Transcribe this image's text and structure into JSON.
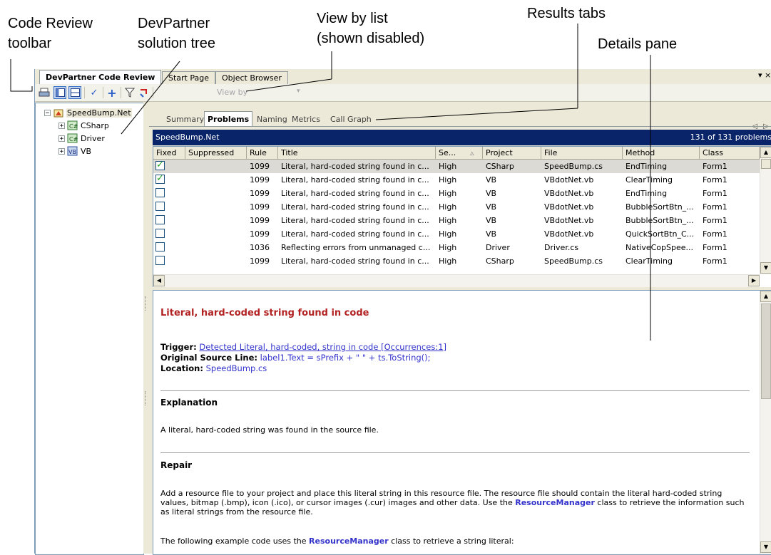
{
  "callouts": {
    "code_review_toolbar": "Code Review\ntoolbar",
    "solution_tree": "DevPartner\nsolution tree",
    "view_by_list": "View by list\n(shown disabled)",
    "results_tabs": "Results tabs",
    "details_pane": "Details pane"
  },
  "doc_tabs": [
    "DevPartner Code Review",
    "Start Page",
    "Object Browser"
  ],
  "window_controls": {
    "dropdown": "▾",
    "close": "×"
  },
  "toolbar": {
    "view_by_label": "View by",
    "view_by_arrow": "▾",
    "icons": [
      "print-icon",
      "tree-pane-icon",
      "split-pane-icon",
      "check-icon",
      "add-icon",
      "filter-icon",
      "refresh-icon"
    ]
  },
  "tree": {
    "root": "SpeedBump.Net",
    "children": [
      "CSharp",
      "Driver",
      "VB"
    ]
  },
  "results_tabs": [
    "Summary",
    "Problems",
    "Naming",
    "Metrics",
    "Call Graph"
  ],
  "tab_nav": {
    "prev": "◁",
    "next": "▷"
  },
  "results_header": {
    "title": "SpeedBump.Net",
    "count": "131 of 131 problems"
  },
  "grid": {
    "columns": [
      "Fixed",
      "Suppressed",
      "Rule",
      "Title",
      "Se...",
      "Project",
      "File",
      "Method",
      "Class"
    ],
    "rows": [
      {
        "fixed": true,
        "rule": "1099",
        "title": "Literal, hard-coded string found in c...",
        "severity": "High",
        "project": "CSharp",
        "file": "SpeedBump.cs",
        "method": "EndTiming",
        "class": "Form1"
      },
      {
        "fixed": true,
        "rule": "1099",
        "title": "Literal, hard-coded string found in c...",
        "severity": "High",
        "project": "VB",
        "file": "VBdotNet.vb",
        "method": "ClearTiming",
        "class": "Form1"
      },
      {
        "fixed": false,
        "rule": "1099",
        "title": "Literal, hard-coded string found in c...",
        "severity": "High",
        "project": "VB",
        "file": "VBdotNet.vb",
        "method": "EndTiming",
        "class": "Form1"
      },
      {
        "fixed": false,
        "rule": "1099",
        "title": "Literal, hard-coded string found in c...",
        "severity": "High",
        "project": "VB",
        "file": "VBdotNet.vb",
        "method": "BubbleSortBtn_...",
        "class": "Form1"
      },
      {
        "fixed": false,
        "rule": "1099",
        "title": "Literal, hard-coded string found in c...",
        "severity": "High",
        "project": "VB",
        "file": "VBdotNet.vb",
        "method": "BubbleSortBtn_...",
        "class": "Form1"
      },
      {
        "fixed": false,
        "rule": "1099",
        "title": "Literal, hard-coded string found in c...",
        "severity": "High",
        "project": "VB",
        "file": "VBdotNet.vb",
        "method": "QuickSortBtn_C...",
        "class": "Form1"
      },
      {
        "fixed": false,
        "rule": "1036",
        "title": "Reflecting errors from unmanaged c...",
        "severity": "High",
        "project": "Driver",
        "file": "Driver.cs",
        "method": "NativeCopSpee...",
        "class": "Form1"
      },
      {
        "fixed": false,
        "rule": "1099",
        "title": "Literal, hard-coded string found in c...",
        "severity": "High",
        "project": "CSharp",
        "file": "SpeedBump.cs",
        "method": "ClearTiming",
        "class": "Form1"
      }
    ]
  },
  "details": {
    "title": "Literal, hard-coded string found in code",
    "trigger_label": "Trigger:",
    "trigger_link": "Detected Literal, hard-coded, string in code [Occurrences:1]",
    "source_label": "Original Source Line:",
    "source_value": "label1.Text = sPrefix + \" \" + ts.ToString();",
    "location_label": "Location:",
    "location_value": "SpeedBump.cs",
    "explanation_heading": "Explanation",
    "explanation_text": "A literal, hard-coded string was found in the source file.",
    "repair_heading": "Repair",
    "repair_p1_a": "Add a resource file to your project and place this literal string in this resource file. The resource file should contain the literal hard-coded string values, bitmap (.bmp), icon (.ico), or cursor images (.cur) images and other data. Use the ",
    "repair_p1_b": "ResourceManager",
    "repair_p1_c": " class to retrieve the information such as literal strings from the resource file.",
    "repair_p2_a": "The following example code uses the ",
    "repair_p2_b": "ResourceManager",
    "repair_p2_c": " class to retrieve a string literal:"
  }
}
